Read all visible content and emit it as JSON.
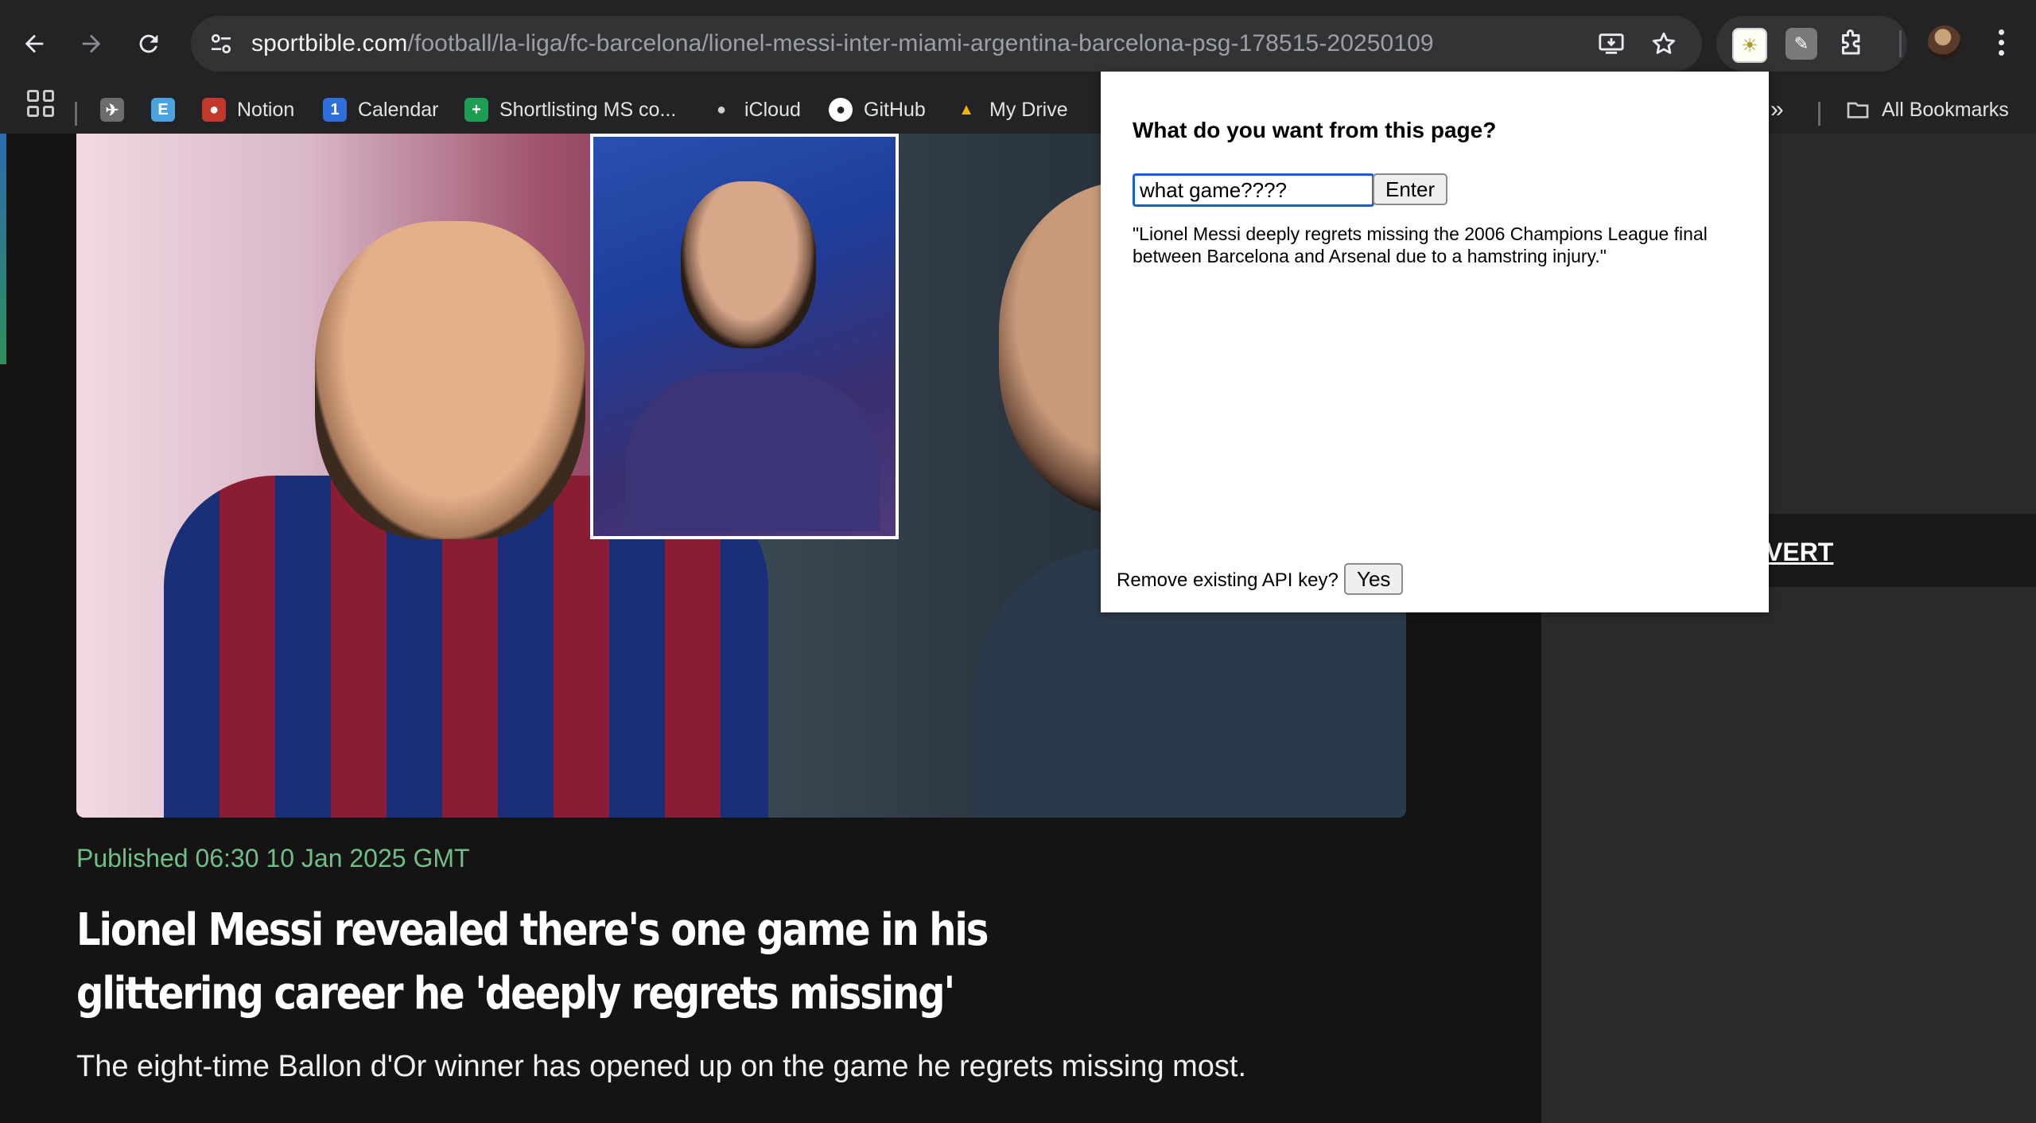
{
  "browser": {
    "url_host": "sportbible.com",
    "url_path": "/football/la-liga/fc-barcelona/lionel-messi-inter-miami-argentina-barcelona-psg-178515-20250109"
  },
  "bookmarks": [
    {
      "label": "Notion",
      "icon": "notion-icon",
      "color": "#c0392b"
    },
    {
      "label": "Calendar",
      "icon": "calendar-icon",
      "color": "#2f6fdc"
    },
    {
      "label": "Shortlisting MS co...",
      "icon": "sheets-icon",
      "color": "#1e9e52"
    },
    {
      "label": "iCloud",
      "icon": "apple-icon",
      "color": "#cfcfcf"
    },
    {
      "label": "GitHub",
      "icon": "github-icon",
      "color": "#ffffff"
    },
    {
      "label": "My Drive",
      "icon": "drive-icon",
      "color": "#f4b400"
    }
  ],
  "all_bookmarks_label": "All Bookmarks",
  "article": {
    "published": "Published 06:30 10 Jan 2025 GMT",
    "headline": "Lionel Messi revealed there's one game in his glittering career he 'deeply regrets missing'",
    "standfirst": "The eight-time Ballon d'Or winner has opened up on the game he regrets missing most."
  },
  "sidebar": {
    "advert_label": "VERT"
  },
  "popup": {
    "title": "What do you want from this page?",
    "query_value": "what game????",
    "enter_label": "Enter",
    "answer": "\"Lionel Messi deeply regrets missing the 2006 Champions League final between Barcelona and Arsenal due to a hamstring injury.\"",
    "remove_key_label": "Remove existing API key?",
    "yes_label": "Yes"
  },
  "colors": {
    "published_green": "#6fbf86",
    "input_focus": "#1a5fc8"
  }
}
